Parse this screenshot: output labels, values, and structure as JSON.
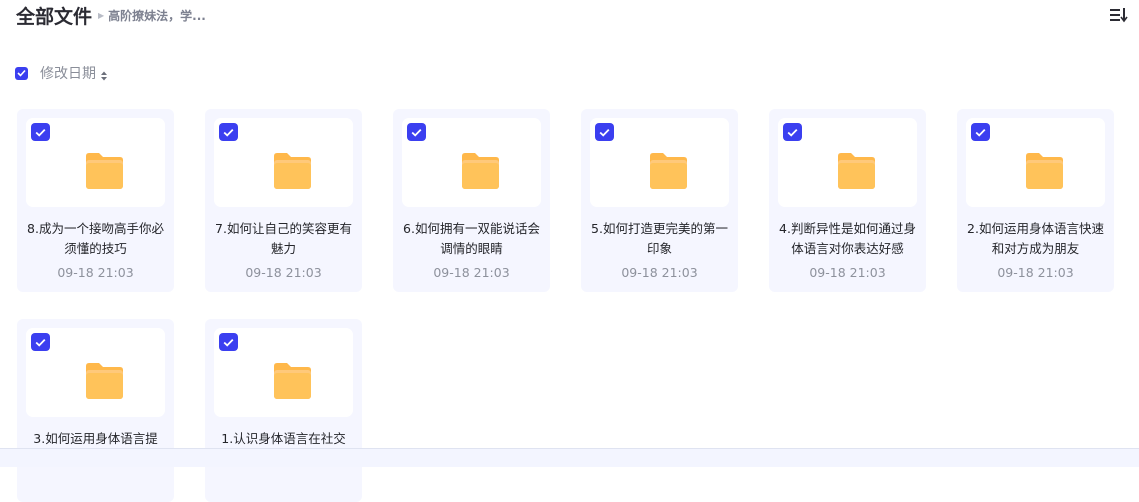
{
  "header": {
    "title": "全部文件",
    "breadcrumb": "高阶撩妹法，学..."
  },
  "sort": {
    "label": "修改日期",
    "all_selected": true
  },
  "colors": {
    "accent": "#3b3ff0",
    "card_bg": "#f5f6ff",
    "folder": "#ffc35a"
  },
  "files": [
    {
      "name": "8.成为一个接吻高手你必须懂的技巧",
      "date": "09-18 21:03",
      "icon": "folder-icon",
      "selected": true
    },
    {
      "name": "7.如何让自己的笑容更有魅力",
      "date": "09-18 21:03",
      "icon": "folder-icon",
      "selected": true
    },
    {
      "name": "6.如何拥有一双能说话会调情的眼睛",
      "date": "09-18 21:03",
      "icon": "folder-icon",
      "selected": true
    },
    {
      "name": "5.如何打造更完美的第一印象",
      "date": "09-18 21:03",
      "icon": "folder-icon",
      "selected": true
    },
    {
      "name": "4.判断异性是如何通过身体语言对你表达好感",
      "date": "09-18 21:03",
      "icon": "folder-icon",
      "selected": true
    },
    {
      "name": "2.如何运用身体语言快速和对方成为朋友",
      "date": "09-18 21:03",
      "icon": "folder-icon",
      "selected": true
    },
    {
      "name": "3.如何运用身体语言提",
      "date": "",
      "icon": "folder-icon",
      "selected": true
    },
    {
      "name": "1.认识身体语言在社交",
      "date": "",
      "icon": "folder-icon",
      "selected": true
    }
  ]
}
